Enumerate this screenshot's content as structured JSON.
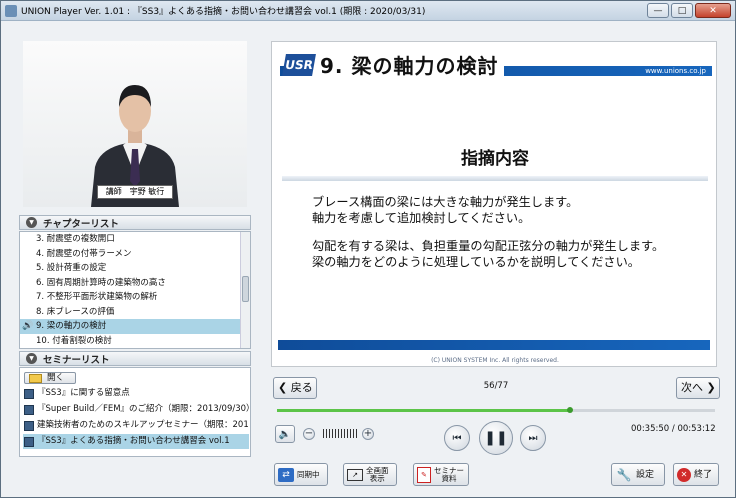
{
  "window": {
    "title": "UNION Player Ver. 1.01 : 『SS3』よくある指摘・お問い合わせ講習会 vol.1 (期限 : 2020/03/31)",
    "minimize_icon": "minimize-icon",
    "maximize_icon": "maximize-icon",
    "close_icon": "close-icon"
  },
  "video": {
    "nameplate": "講師　宇野 敏行"
  },
  "chapter_list": {
    "header": "チャプターリスト",
    "items": [
      {
        "label": "3. 耐震壁の複数開口"
      },
      {
        "label": "4. 耐震壁の付帯ラーメン"
      },
      {
        "label": "5. 設計荷重の設定"
      },
      {
        "label": "6. 固有周期計算時の建築物の高さ"
      },
      {
        "label": "7. 不整形平面形状建築物の解析"
      },
      {
        "label": "8. 床ブレースの評価"
      },
      {
        "label": "9. 梁の軸力の検討"
      },
      {
        "label": "10. 付着割裂の検討"
      }
    ],
    "selected_index": 6
  },
  "seminar_list": {
    "header": "セミナーリスト",
    "open_label": "開く",
    "items": [
      {
        "label": "『SS3』に関する留意点"
      },
      {
        "label": "『Super Build／FEM』のご紹介（期限：2013/09/30）"
      },
      {
        "label": "建築技術者のためのスキルアップセミナー（期限：2012/"
      },
      {
        "label": "『SS3』よくある指摘・お問い合わせ講習会 vol.1"
      }
    ],
    "selected_index": 3
  },
  "slide": {
    "logo": "USR",
    "title": "9. 梁の軸力の検討",
    "url": "www.unions.co.jp",
    "heading": "指摘内容",
    "para1_line1": "ブレース構面の梁には大きな軸力が発生します。",
    "para1_line2": "軸力を考慮して追加検討してください。",
    "para2_line1": "勾配を有する梁は、負担重量の勾配正弦分の軸力が発生します。",
    "para2_line2": "梁の軸力をどのように処理しているかを説明してください。",
    "copyright": "(C)  UNION SYSTEM Inc. All rights reserved."
  },
  "nav": {
    "prev_label": "戻る",
    "next_label": "次へ",
    "page": "56/77"
  },
  "playback": {
    "progress": 0.67,
    "time": "00:35:50 / 00:53:12"
  },
  "toolbar": {
    "sync_label": "同期中",
    "fullscreen_label1": "全画面",
    "fullscreen_label2": "表示",
    "seminar_doc_label1": "セミナー",
    "seminar_doc_label2": "資料",
    "settings_label": "設定",
    "exit_label": "終了"
  }
}
